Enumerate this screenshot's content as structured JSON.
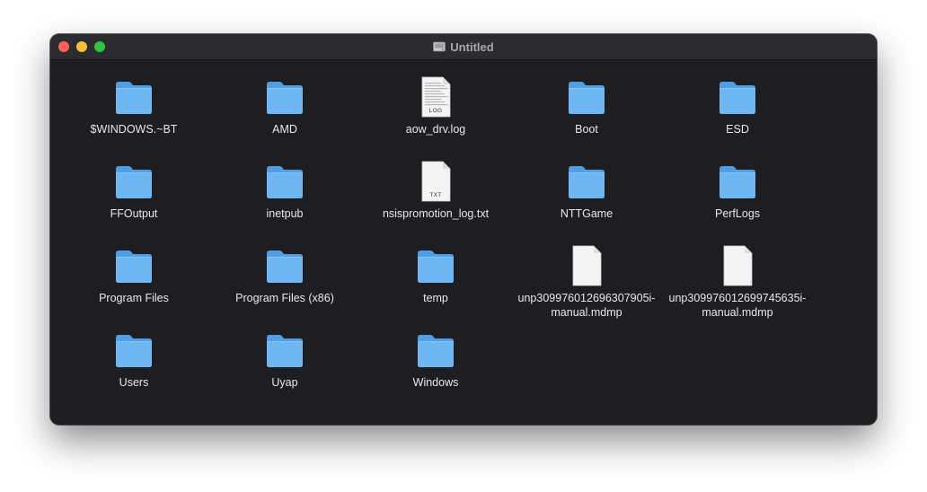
{
  "window": {
    "title": "Untitled",
    "title_icon": "drive-icon"
  },
  "colors": {
    "window_bg": "#1e1d22",
    "titlebar_bg": "#2c2b30",
    "folder_front": "#6fb7f2",
    "folder_back": "#4f9fe6",
    "close": "#fe5f57",
    "minimize": "#febc2e",
    "maximize": "#28c840"
  },
  "items": [
    {
      "name": "$WINDOWS.~BT",
      "kind": "folder"
    },
    {
      "name": "AMD",
      "kind": "folder"
    },
    {
      "name": "aow_drv.log",
      "kind": "log-file",
      "badge": "LOG"
    },
    {
      "name": "Boot",
      "kind": "folder"
    },
    {
      "name": "ESD",
      "kind": "folder"
    },
    {
      "name": "FFOutput",
      "kind": "folder"
    },
    {
      "name": "inetpub",
      "kind": "folder"
    },
    {
      "name": "nsispromotion_log.txt",
      "kind": "text-file",
      "badge": "TXT"
    },
    {
      "name": "NTTGame",
      "kind": "folder"
    },
    {
      "name": "PerfLogs",
      "kind": "folder"
    },
    {
      "name": "Program Files",
      "kind": "folder"
    },
    {
      "name": "Program Files (x86)",
      "kind": "folder"
    },
    {
      "name": "temp",
      "kind": "folder"
    },
    {
      "name": "unp309976012696307905i-manual.mdmp",
      "kind": "generic-file"
    },
    {
      "name": "unp309976012699745635i-manual.mdmp",
      "kind": "generic-file"
    },
    {
      "name": "Users",
      "kind": "folder"
    },
    {
      "name": "Uyap",
      "kind": "folder"
    },
    {
      "name": "Windows",
      "kind": "folder"
    }
  ]
}
